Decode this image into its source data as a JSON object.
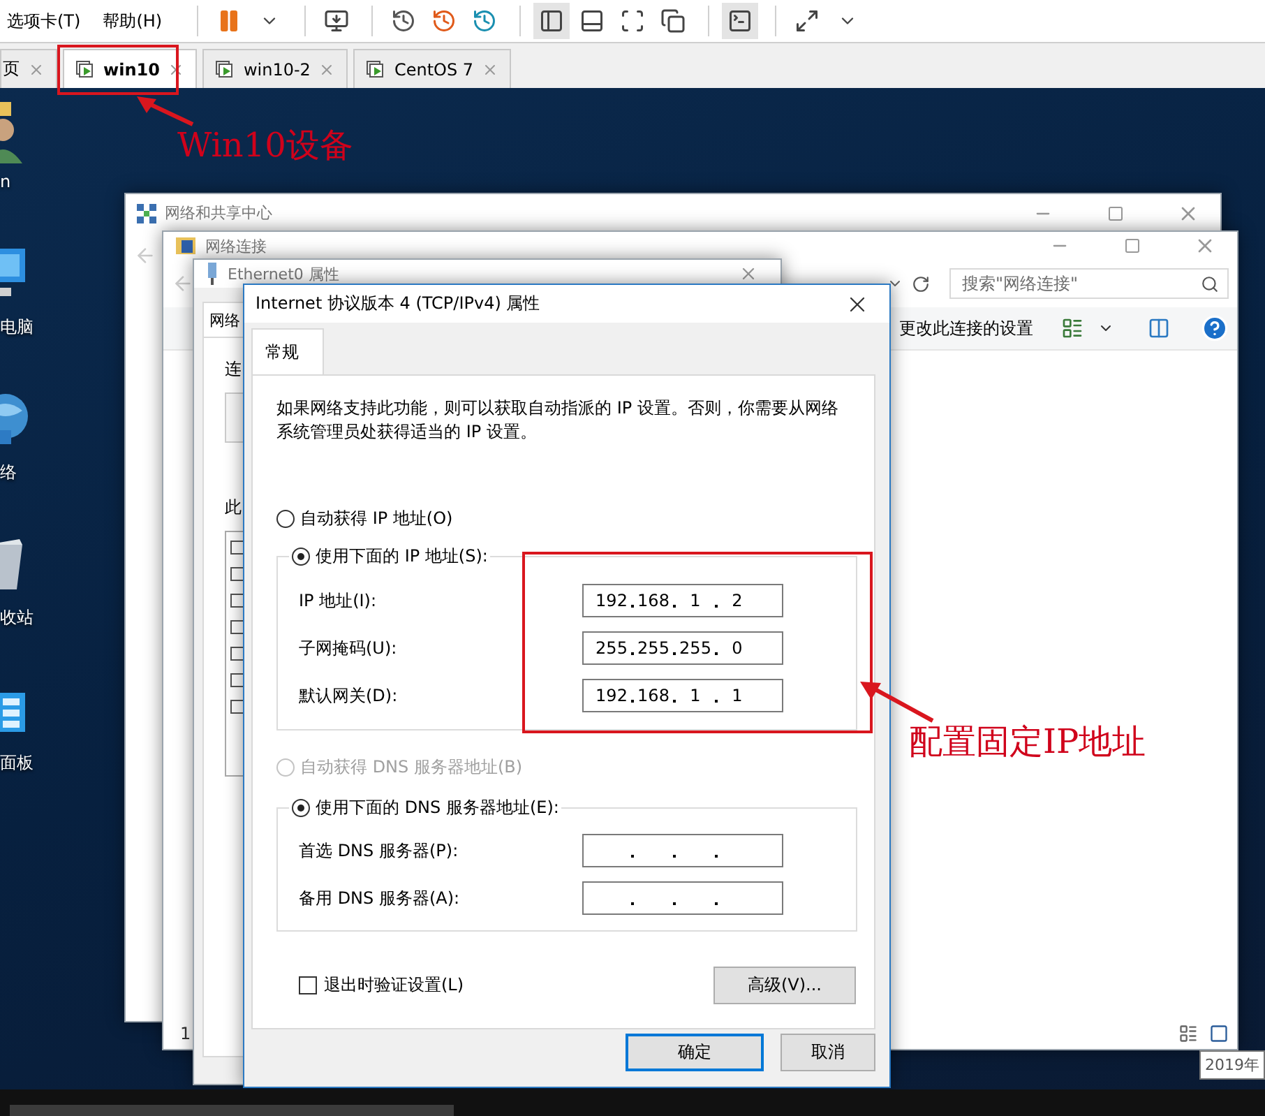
{
  "menu": [
    {
      "label": "选项卡(T)"
    },
    {
      "label": "帮助(H)"
    }
  ],
  "vm_tabs": [
    {
      "label": "页",
      "selected": false
    },
    {
      "label": "win10",
      "selected": true
    },
    {
      "label": "win10-2",
      "selected": false
    },
    {
      "label": "CentOS 7",
      "selected": false
    }
  ],
  "desktop_icons": [
    {
      "kind": "user",
      "label": "n"
    },
    {
      "kind": "computer",
      "label": "电脑"
    },
    {
      "kind": "network",
      "label": "络"
    },
    {
      "kind": "bin",
      "label": "收站"
    },
    {
      "kind": "panel",
      "label": "面板"
    }
  ],
  "sharing_center": {
    "title": "网络和共享中心"
  },
  "connections": {
    "title": "网络连接",
    "search": {
      "placeholder": "搜索\"网络连接\""
    },
    "command": "更改此连接的设置",
    "status": "1"
  },
  "ethernet_properties": {
    "title": "Ethernet0 属性",
    "tab": "网络",
    "labels": [
      "连",
      "此"
    ]
  },
  "dialog": {
    "title": "Internet 协议版本 4 (TCP/IPv4) 属性",
    "tabs": [
      {
        "label": "常规",
        "selected": true
      }
    ],
    "description": "如果网络支持此功能，则可以获取自动指派的 IP 设置。否则，你需要从网络系统管理员处获得适当的 IP 设置。",
    "ip_mode": [
      {
        "label": "自动获得 IP 地址(O)",
        "selected": false,
        "disabled": false
      },
      {
        "label": "使用下面的 IP 地址(S):",
        "selected": true,
        "disabled": false
      }
    ],
    "ip_fields": [
      {
        "label": "IP 地址(I):",
        "octets": [
          "192",
          "168",
          "1",
          "2"
        ]
      },
      {
        "label": "子网掩码(U):",
        "octets": [
          "255",
          "255",
          "255",
          "0"
        ]
      },
      {
        "label": "默认网关(D):",
        "octets": [
          "192",
          "168",
          "1",
          "1"
        ]
      }
    ],
    "dns_mode": [
      {
        "label": "自动获得 DNS 服务器地址(B)",
        "selected": false,
        "disabled": true
      },
      {
        "label": "使用下面的 DNS 服务器地址(E):",
        "selected": true,
        "disabled": false
      }
    ],
    "dns_fields": [
      {
        "label": "首选 DNS 服务器(P):"
      },
      {
        "label": "备用 DNS 服务器(A):"
      }
    ],
    "validate": {
      "label": "退出时验证设置(L)",
      "checked": false
    },
    "advanced_button": "高级(V)...",
    "buttons": [
      {
        "label": "确定",
        "default": true
      },
      {
        "label": "取消",
        "default": false
      }
    ]
  },
  "tooltip": "2019年",
  "annotations": [
    {
      "text": "Win10设备"
    },
    {
      "text": "配置固定IP地址"
    }
  ]
}
